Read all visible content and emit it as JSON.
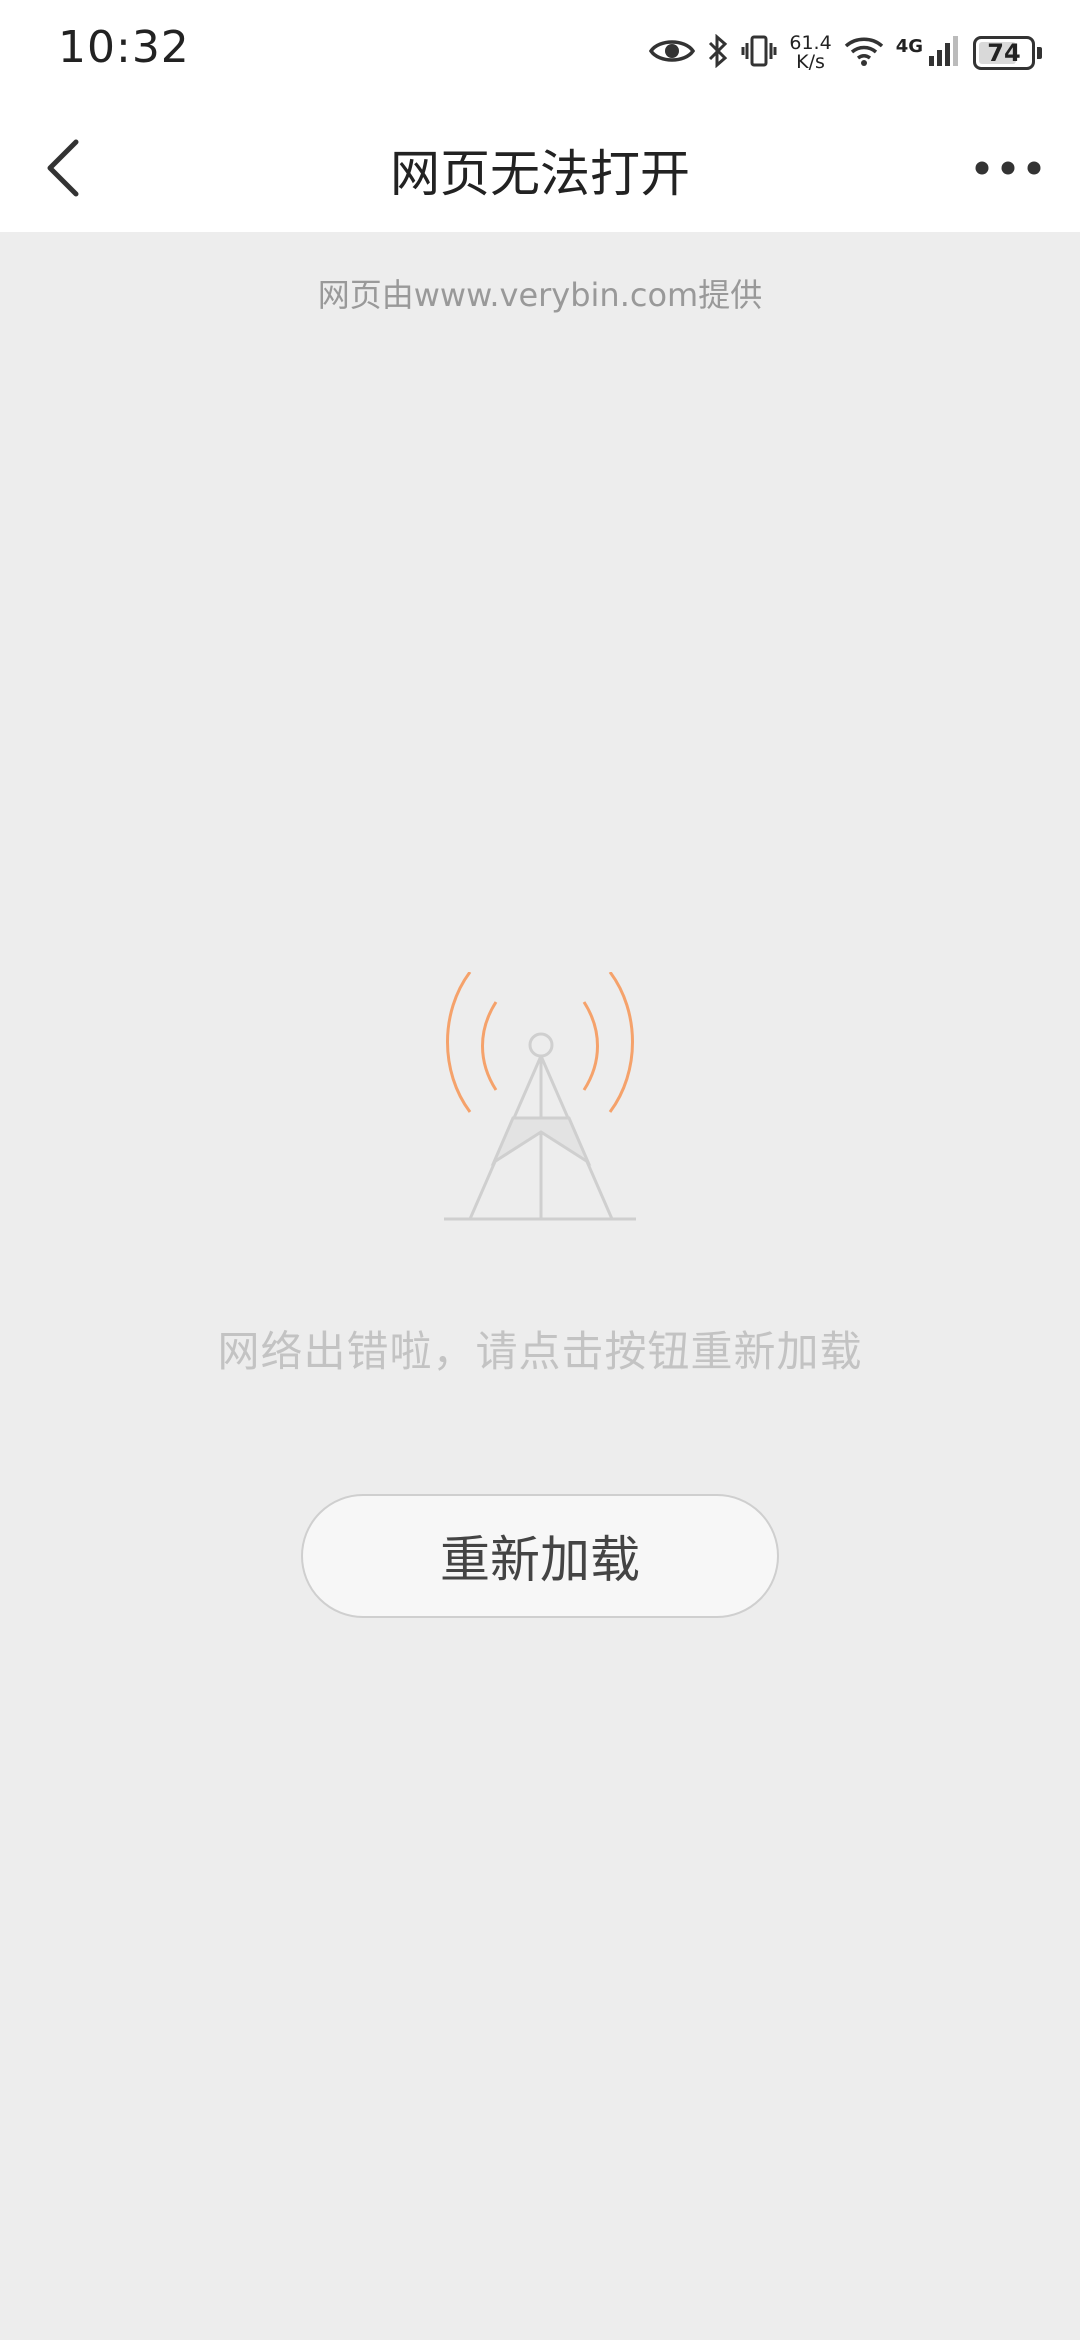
{
  "status_bar": {
    "time": "10:32",
    "net_speed_value": "61.4",
    "net_speed_unit": "K/s",
    "network_type": "4G",
    "battery_level": "74",
    "battery_fraction": 0.74,
    "icons": [
      "eye-icon",
      "bluetooth-icon",
      "vibrate-icon",
      "wifi-icon",
      "signal-icon",
      "battery-icon"
    ]
  },
  "nav": {
    "title": "网页无法打开",
    "back_icon": "chevron-left-icon",
    "more_icon": "more-horizontal-icon"
  },
  "content": {
    "provider": "网页由www.verybin.com提供",
    "error_message": "网络出错啦，请点击按钮重新加载",
    "reload_label": "重新加载",
    "illustration_icon": "signal-tower-icon",
    "accent_color": "#f5a26b"
  }
}
